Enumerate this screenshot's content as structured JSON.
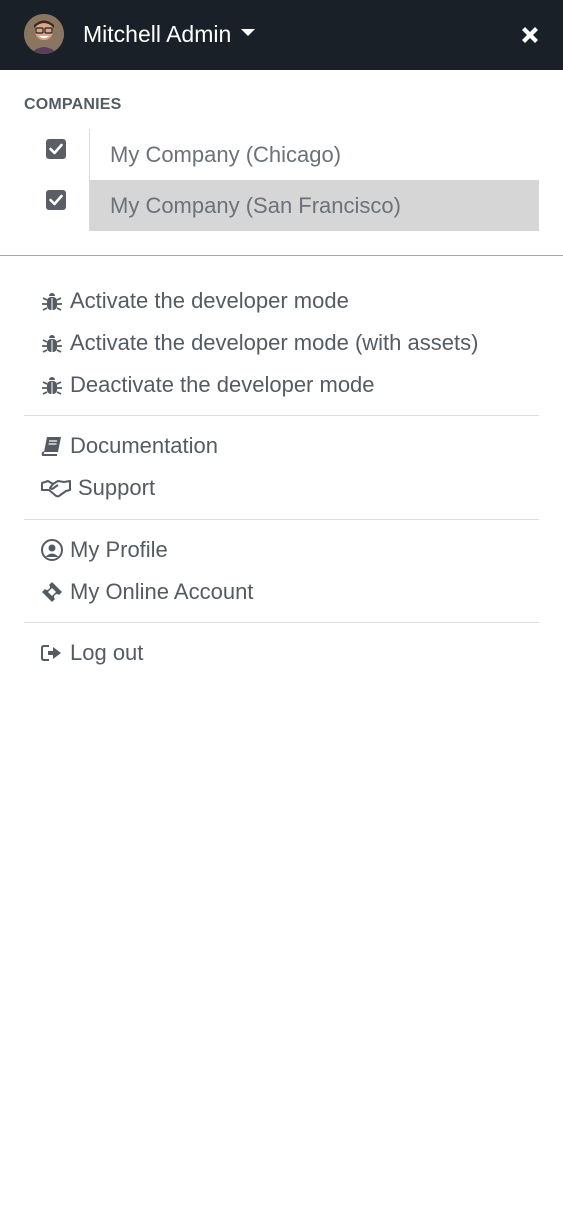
{
  "header": {
    "user_name": "Mitchell Admin",
    "close_icon": "close-icon",
    "caret_icon": "caret-down-icon"
  },
  "companies": {
    "title": "COMPANIES",
    "items": [
      {
        "label": "My Company (Chicago)",
        "checked": true,
        "active": false
      },
      {
        "label": "My Company (San Francisco)",
        "checked": true,
        "active": true
      }
    ]
  },
  "menu": {
    "developer": [
      {
        "label": "Activate the developer mode",
        "icon": "bug-icon"
      },
      {
        "label": "Activate the developer mode (with assets)",
        "icon": "bug-icon"
      },
      {
        "label": "Deactivate the developer mode",
        "icon": "bug-icon"
      }
    ],
    "help": [
      {
        "label": "Documentation",
        "icon": "book-icon"
      },
      {
        "label": "Support",
        "icon": "handshake-icon"
      }
    ],
    "account": [
      {
        "label": "My Profile",
        "icon": "user-circle-icon"
      },
      {
        "label": "My Online Account",
        "icon": "ticket-icon"
      }
    ],
    "session": [
      {
        "label": "Log out",
        "icon": "sign-out-icon"
      }
    ]
  },
  "colors": {
    "header_bg": "#1a2028",
    "text": "#555b63",
    "active_row": "#d6d6d6"
  }
}
